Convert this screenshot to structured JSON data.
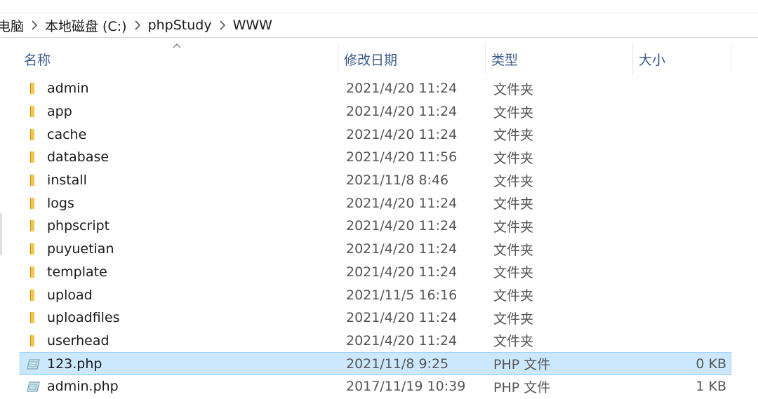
{
  "breadcrumb": {
    "items": [
      "电脑",
      "本地磁盘 (C:)",
      "phpStudy",
      "WWW"
    ]
  },
  "columns": {
    "name": "名称",
    "date": "修改日期",
    "type": "类型",
    "size": "大小"
  },
  "files": [
    {
      "name": "admin",
      "date": "2021/4/20 11:24",
      "type": "文件夹",
      "size": "",
      "icon": "folder-icon"
    },
    {
      "name": "app",
      "date": "2021/4/20 11:24",
      "type": "文件夹",
      "size": "",
      "icon": "folder-icon"
    },
    {
      "name": "cache",
      "date": "2021/4/20 11:24",
      "type": "文件夹",
      "size": "",
      "icon": "folder-icon"
    },
    {
      "name": "database",
      "date": "2021/4/20 11:56",
      "type": "文件夹",
      "size": "",
      "icon": "folder-icon"
    },
    {
      "name": "install",
      "date": "2021/11/8 8:46",
      "type": "文件夹",
      "size": "",
      "icon": "folder-icon"
    },
    {
      "name": "logs",
      "date": "2021/4/20 11:24",
      "type": "文件夹",
      "size": "",
      "icon": "folder-icon"
    },
    {
      "name": "phpscript",
      "date": "2021/4/20 11:24",
      "type": "文件夹",
      "size": "",
      "icon": "folder-icon"
    },
    {
      "name": "puyuetian",
      "date": "2021/4/20 11:24",
      "type": "文件夹",
      "size": "",
      "icon": "folder-icon"
    },
    {
      "name": "template",
      "date": "2021/4/20 11:24",
      "type": "文件夹",
      "size": "",
      "icon": "folder-icon"
    },
    {
      "name": "upload",
      "date": "2021/11/5 16:16",
      "type": "文件夹",
      "size": "",
      "icon": "folder-icon"
    },
    {
      "name": "uploadfiles",
      "date": "2021/4/20 11:24",
      "type": "文件夹",
      "size": "",
      "icon": "folder-icon"
    },
    {
      "name": "userhead",
      "date": "2021/4/20 11:24",
      "type": "文件夹",
      "size": "",
      "icon": "folder-icon"
    },
    {
      "name": "123.php",
      "date": "2021/11/8 9:25",
      "type": "PHP 文件",
      "size": "0 KB",
      "icon": "php-file-icon",
      "selected": true
    },
    {
      "name": "admin.php",
      "date": "2017/11/19 10:39",
      "type": "PHP 文件",
      "size": "1 KB",
      "icon": "php-file-icon"
    }
  ],
  "colors": {
    "selection_bg": "#cce8ff",
    "selection_border": "#99d1ff",
    "header_text": "#3c5a8a",
    "folder": "#f3c64d"
  }
}
